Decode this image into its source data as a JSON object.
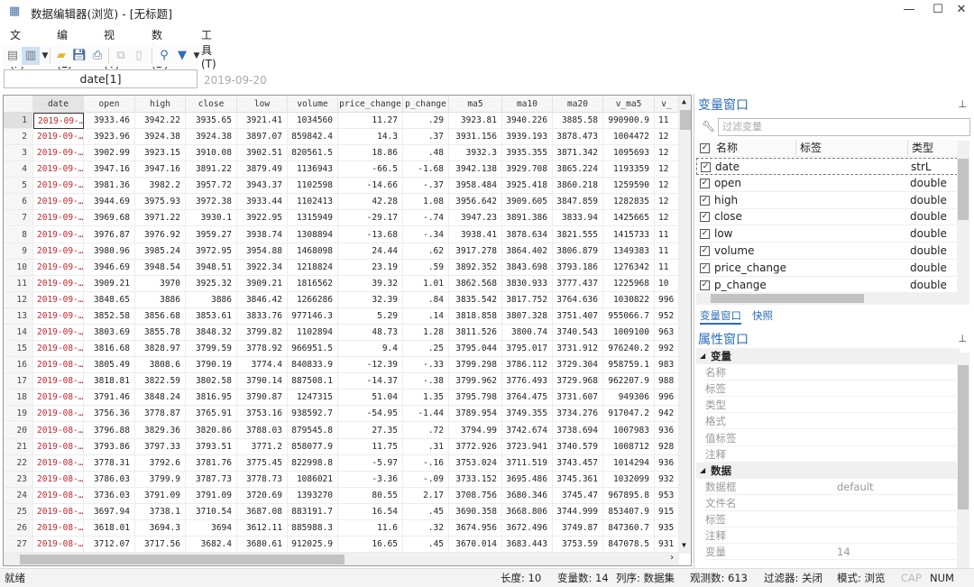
{
  "window": {
    "title": "数据编辑器(浏览) - [无标题]",
    "icon": "table-icon"
  },
  "menu": [
    "文件(F)",
    "编辑(E)",
    "视图(V)",
    "数据(D)",
    "工具(T)"
  ],
  "toolbar": [
    "properties-icon",
    "browse-mode-icon",
    "open-folder-icon",
    "save-icon",
    "print-icon",
    "copy-icon",
    "paste-icon",
    "search-icon",
    "filter-icon"
  ],
  "cellbar": {
    "varname": "date[1]",
    "value": "2019-09-20"
  },
  "grid": {
    "columns": [
      "date",
      "open",
      "high",
      "close",
      "low",
      "volume",
      "price_change",
      "p_change",
      "ma5",
      "ma10",
      "ma20",
      "v_ma5",
      "v_"
    ],
    "rows": [
      [
        "2019-09-…",
        "3933.46",
        "3942.22",
        "3935.65",
        "3921.41",
        "1034560",
        "11.27",
        ".29",
        "3923.81",
        "3940.226",
        "3885.58",
        "990900.9",
        "11"
      ],
      [
        "2019-09-…",
        "3923.96",
        "3924.38",
        "3924.38",
        "3897.07",
        "859842.4",
        "14.3",
        ".37",
        "3931.156",
        "3939.193",
        "3878.473",
        "1004472",
        "12"
      ],
      [
        "2019-09-…",
        "3902.99",
        "3923.15",
        "3910.08",
        "3902.51",
        "820561.5",
        "18.86",
        ".48",
        "3932.3",
        "3935.355",
        "3871.342",
        "1095693",
        "12"
      ],
      [
        "2019-09-…",
        "3947.16",
        "3947.16",
        "3891.22",
        "3879.49",
        "1136943",
        "-66.5",
        "-1.68",
        "3942.138",
        "3929.708",
        "3865.224",
        "1193359",
        "12"
      ],
      [
        "2019-09-…",
        "3981.36",
        "3982.2",
        "3957.72",
        "3943.37",
        "1102598",
        "-14.66",
        "-.37",
        "3958.484",
        "3925.418",
        "3860.218",
        "1259590",
        "12"
      ],
      [
        "2019-09-…",
        "3944.69",
        "3975.93",
        "3972.38",
        "3933.44",
        "1102413",
        "42.28",
        "1.08",
        "3956.642",
        "3909.605",
        "3847.859",
        "1282835",
        "12"
      ],
      [
        "2019-09-…",
        "3969.68",
        "3971.22",
        "3930.1",
        "3922.95",
        "1315949",
        "-29.17",
        "-.74",
        "3947.23",
        "3891.386",
        "3833.94",
        "1425665",
        "12"
      ],
      [
        "2019-09-…",
        "3976.87",
        "3976.92",
        "3959.27",
        "3938.74",
        "1308894",
        "-13.68",
        "-.34",
        "3938.41",
        "3878.634",
        "3821.555",
        "1415733",
        "11"
      ],
      [
        "2019-09-…",
        "3980.96",
        "3985.24",
        "3972.95",
        "3954.88",
        "1468098",
        "24.44",
        ".62",
        "3917.278",
        "3864.402",
        "3806.879",
        "1349383",
        "11"
      ],
      [
        "2019-09-…",
        "3946.69",
        "3948.54",
        "3948.51",
        "3922.34",
        "1218824",
        "23.19",
        ".59",
        "3892.352",
        "3843.698",
        "3793.186",
        "1276342",
        "11"
      ],
      [
        "2019-09-…",
        "3909.21",
        "3970",
        "3925.32",
        "3909.21",
        "1816562",
        "39.32",
        "1.01",
        "3862.568",
        "3830.933",
        "3777.437",
        "1225968",
        "10"
      ],
      [
        "2019-09-…",
        "3848.65",
        "3886",
        "3886",
        "3846.42",
        "1266286",
        "32.39",
        ".84",
        "3835.542",
        "3817.752",
        "3764.636",
        "1030822",
        "996"
      ],
      [
        "2019-09-…",
        "3852.58",
        "3856.68",
        "3853.61",
        "3833.76",
        "977146.3",
        "5.29",
        ".14",
        "3818.858",
        "3807.328",
        "3751.407",
        "955066.7",
        "952"
      ],
      [
        "2019-09-…",
        "3803.69",
        "3855.78",
        "3848.32",
        "3799.82",
        "1102894",
        "48.73",
        "1.28",
        "3811.526",
        "3800.74",
        "3740.543",
        "1009100",
        "963"
      ],
      [
        "2019-08-…",
        "3816.68",
        "3828.97",
        "3799.59",
        "3778.92",
        "966951.5",
        "9.4",
        ".25",
        "3795.044",
        "3795.017",
        "3731.912",
        "976240.2",
        "992"
      ],
      [
        "2019-08-…",
        "3805.49",
        "3808.6",
        "3790.19",
        "3774.4",
        "840833.9",
        "-12.39",
        "-.33",
        "3799.298",
        "3786.112",
        "3729.304",
        "958759.1",
        "983"
      ],
      [
        "2019-08-…",
        "3818.81",
        "3822.59",
        "3802.58",
        "3790.14",
        "887508.1",
        "-14.37",
        "-.38",
        "3799.962",
        "3776.493",
        "3729.968",
        "962207.9",
        "988"
      ],
      [
        "2019-08-…",
        "3791.46",
        "3848.24",
        "3816.95",
        "3790.87",
        "1247315",
        "51.04",
        "1.35",
        "3795.798",
        "3764.475",
        "3731.607",
        "949306",
        "996"
      ],
      [
        "2019-08-…",
        "3756.36",
        "3778.87",
        "3765.91",
        "3753.16",
        "938592.7",
        "-54.95",
        "-1.44",
        "3789.954",
        "3749.355",
        "3734.276",
        "917047.2",
        "942"
      ],
      [
        "2019-08-…",
        "3796.88",
        "3829.36",
        "3820.86",
        "3788.03",
        "879545.8",
        "27.35",
        ".72",
        "3794.99",
        "3742.674",
        "3738.694",
        "1007983",
        "936"
      ],
      [
        "2019-08-…",
        "3793.86",
        "3797.33",
        "3793.51",
        "3771.2",
        "858077.9",
        "11.75",
        ".31",
        "3772.926",
        "3723.941",
        "3740.579",
        "1008712",
        "928"
      ],
      [
        "2019-08-…",
        "3778.31",
        "3792.6",
        "3781.76",
        "3775.45",
        "822998.8",
        "-5.97",
        "-.16",
        "3753.024",
        "3711.519",
        "3743.457",
        "1014294",
        "936"
      ],
      [
        "2019-08-…",
        "3786.03",
        "3799.9",
        "3787.73",
        "3778.73",
        "1086021",
        "-3.36",
        "-.09",
        "3733.152",
        "3695.486",
        "3745.361",
        "1032099",
        "932"
      ],
      [
        "2019-08-…",
        "3736.03",
        "3791.09",
        "3791.09",
        "3720.69",
        "1393270",
        "80.55",
        "2.17",
        "3708.756",
        "3680.346",
        "3745.47",
        "967895.8",
        "953"
      ],
      [
        "2019-08-…",
        "3697.94",
        "3738.1",
        "3710.54",
        "3687.08",
        "883191.7",
        "16.54",
        ".45",
        "3690.358",
        "3668.806",
        "3744.999",
        "853407.9",
        "915"
      ],
      [
        "2019-08-…",
        "3618.01",
        "3694.3",
        "3694",
        "3612.11",
        "885988.3",
        "11.6",
        ".32",
        "3674.956",
        "3672.496",
        "3749.87",
        "847360.7",
        "935"
      ],
      [
        "2019-08-…",
        "3712.07",
        "3717.56",
        "3682.4",
        "3680.61",
        "912025.9",
        "16.65",
        ".45",
        "3670.014",
        "3683.443",
        "3753.59",
        "847078.5",
        "931"
      ]
    ]
  },
  "varwindow": {
    "title": "变量窗口",
    "filter_placeholder": "过滤变量",
    "headers": [
      "名称",
      "标签",
      "类型"
    ],
    "vars": [
      {
        "name": "date",
        "type": "strL"
      },
      {
        "name": "open",
        "type": "double"
      },
      {
        "name": "high",
        "type": "double"
      },
      {
        "name": "close",
        "type": "double"
      },
      {
        "name": "low",
        "type": "double"
      },
      {
        "name": "volume",
        "type": "double"
      },
      {
        "name": "price_change",
        "type": "double"
      },
      {
        "name": "p_change",
        "type": "double"
      }
    ],
    "tabs": [
      "变量窗口",
      "快照"
    ]
  },
  "propwindow": {
    "title": "属性窗口",
    "items": [
      {
        "label": "变量",
        "section": true
      },
      {
        "label": "名称"
      },
      {
        "label": "标签"
      },
      {
        "label": "类型"
      },
      {
        "label": "格式"
      },
      {
        "label": "值标签"
      },
      {
        "label": "注释"
      },
      {
        "label": "数据",
        "section": true
      },
      {
        "label": "数据框",
        "value": "default"
      },
      {
        "label": "文件名"
      },
      {
        "label": "标签"
      },
      {
        "label": "注释"
      },
      {
        "label": "变量",
        "value": "14"
      }
    ]
  },
  "status": {
    "left": "就绪",
    "length": "长度: 10",
    "vars": "变量数: 14",
    "order": "列序: 数据集",
    "obs": "观测数: 613",
    "filter": "过滤器: 关闭",
    "mode": "模式: 浏览",
    "cap": "CAP",
    "num": "NUM"
  },
  "colors": {
    "accent": "#2a6ebb",
    "date_text": "#c0272d"
  }
}
